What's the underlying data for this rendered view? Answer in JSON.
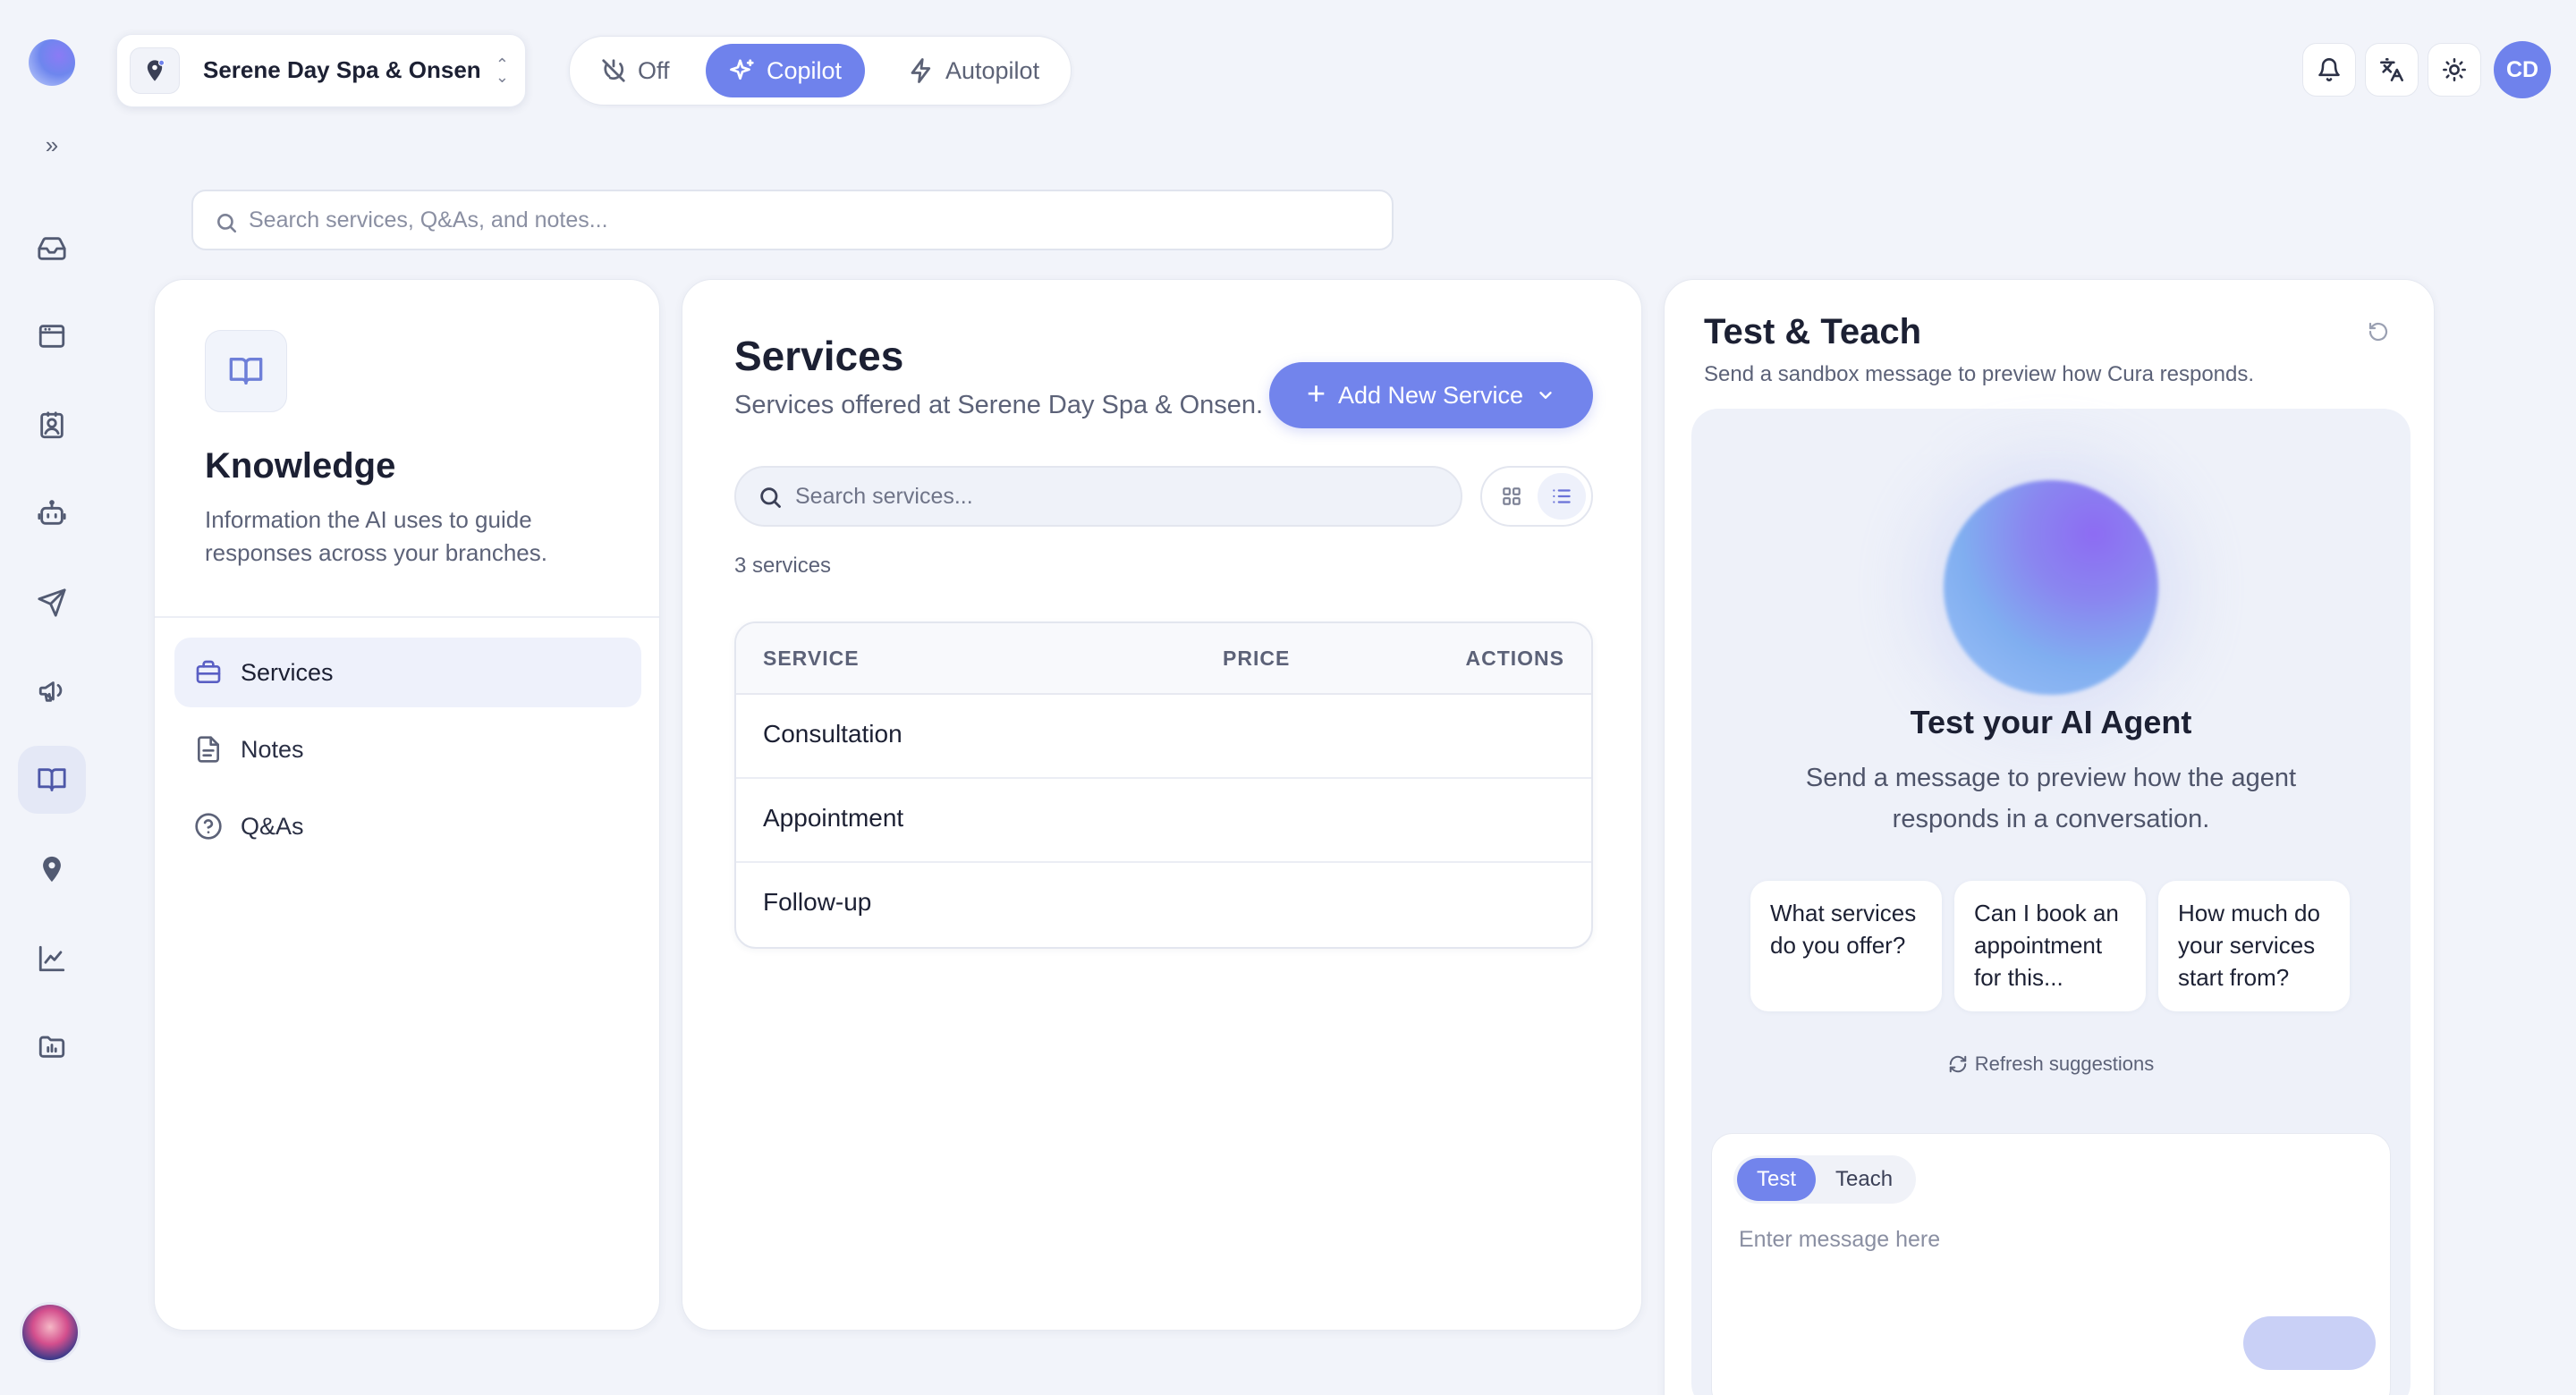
{
  "branch": {
    "name": "Serene Day Spa & Onsen"
  },
  "modes": [
    {
      "label": "Off",
      "icon": "off-icon",
      "active": false
    },
    {
      "label": "Copilot",
      "icon": "sparkle-icon",
      "active": true
    },
    {
      "label": "Autopilot",
      "icon": "bolt-icon",
      "active": false
    }
  ],
  "user": {
    "initials": "CD"
  },
  "search": {
    "placeholder": "Search services, Q&As, and notes..."
  },
  "knowledge": {
    "title": "Knowledge",
    "description": "Information the AI uses to guide responses across your branches.",
    "nav": [
      {
        "label": "Services",
        "icon": "briefcase-icon",
        "active": true
      },
      {
        "label": "Notes",
        "icon": "document-icon",
        "active": false
      },
      {
        "label": "Q&As",
        "icon": "help-circle-icon",
        "active": false
      }
    ]
  },
  "services": {
    "title": "Services",
    "subtitle": "Services offered at Serene Day Spa & Onsen.",
    "add_button": "Add New Service",
    "search_placeholder": "Search services...",
    "count": "3 services",
    "columns": [
      "SERVICE",
      "PRICE",
      "ACTIONS"
    ],
    "rows": [
      {
        "name": "Consultation",
        "price": "",
        "actions": ""
      },
      {
        "name": "Appointment",
        "price": "",
        "actions": ""
      },
      {
        "name": "Follow-up",
        "price": "",
        "actions": ""
      }
    ]
  },
  "test_teach": {
    "title": "Test & Teach",
    "subtitle": "Send a sandbox message to preview how Cura responds.",
    "heading": "Test your AI Agent",
    "description": "Send a message to preview how the agent responds in a conversation.",
    "suggestions": [
      "What services do you offer?",
      "Can I book an appointment for this...",
      "How much do your services start from?"
    ],
    "refresh_label": "Refresh suggestions",
    "tabs": [
      "Test",
      "Teach"
    ],
    "active_tab": "Test",
    "message_placeholder": "Enter message here"
  },
  "colors": {
    "accent": "#7284ec",
    "background": "#f2f4fa",
    "card": "#ffffff"
  }
}
